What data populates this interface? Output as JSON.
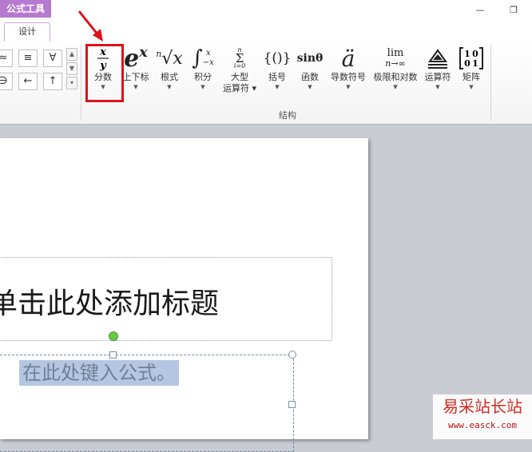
{
  "window": {
    "contextual_group": "公式工具",
    "contextual_tab": "设计",
    "minimize_glyph": "—",
    "restore_glyph": "❐"
  },
  "ribbon": {
    "symbols_row1": [
      "≈",
      "≡",
      "∀"
    ],
    "symbols_row2": [
      "∋",
      "←",
      "↑"
    ],
    "tools": [
      {
        "label": "分数",
        "line2": ""
      },
      {
        "label": "上下标",
        "line2": ""
      },
      {
        "label": "根式",
        "line2": ""
      },
      {
        "label": "积分",
        "line2": ""
      },
      {
        "label": "大型",
        "line2": "运算符"
      },
      {
        "label": "括号",
        "line2": ""
      },
      {
        "label": "函数",
        "line2": ""
      },
      {
        "label": "导数符号",
        "line2": ""
      },
      {
        "label": "极限和对数",
        "line2": ""
      },
      {
        "label": "运算符",
        "line2": ""
      },
      {
        "label": "矩阵",
        "line2": ""
      }
    ],
    "group_label": "结构",
    "glyphs": {
      "fraction_num": "x",
      "fraction_den": "y",
      "script_base": "e",
      "script_sup": "x",
      "radical_index": "n",
      "radical_body": "√x",
      "integral": "∫",
      "integral_upper": "x",
      "integral_lower": "−x",
      "sum_top": "n",
      "sum": "Σ",
      "sum_bottom": "i=0",
      "bracket": "{()}",
      "function": "sinθ",
      "accent": "ä",
      "limit_top": "lim",
      "limit_bottom": "n→∞",
      "operator": "≜",
      "matrix": "[10 01]"
    }
  },
  "slide": {
    "title_placeholder": "单击此处添加标题",
    "equation_placeholder": "在此处键入公式。"
  },
  "watermark": {
    "title": "易采站长站",
    "url": "www.easck.com"
  }
}
